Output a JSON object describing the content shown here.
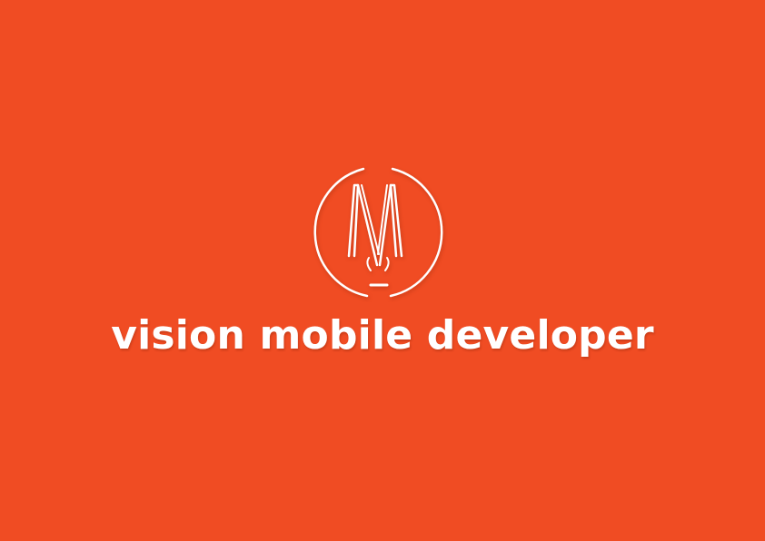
{
  "brand": {
    "name": "vision mobile developer",
    "logo_icon": "vm-monogram-circle-icon"
  },
  "colors": {
    "background": "#f04c23",
    "foreground": "#ffffff"
  }
}
